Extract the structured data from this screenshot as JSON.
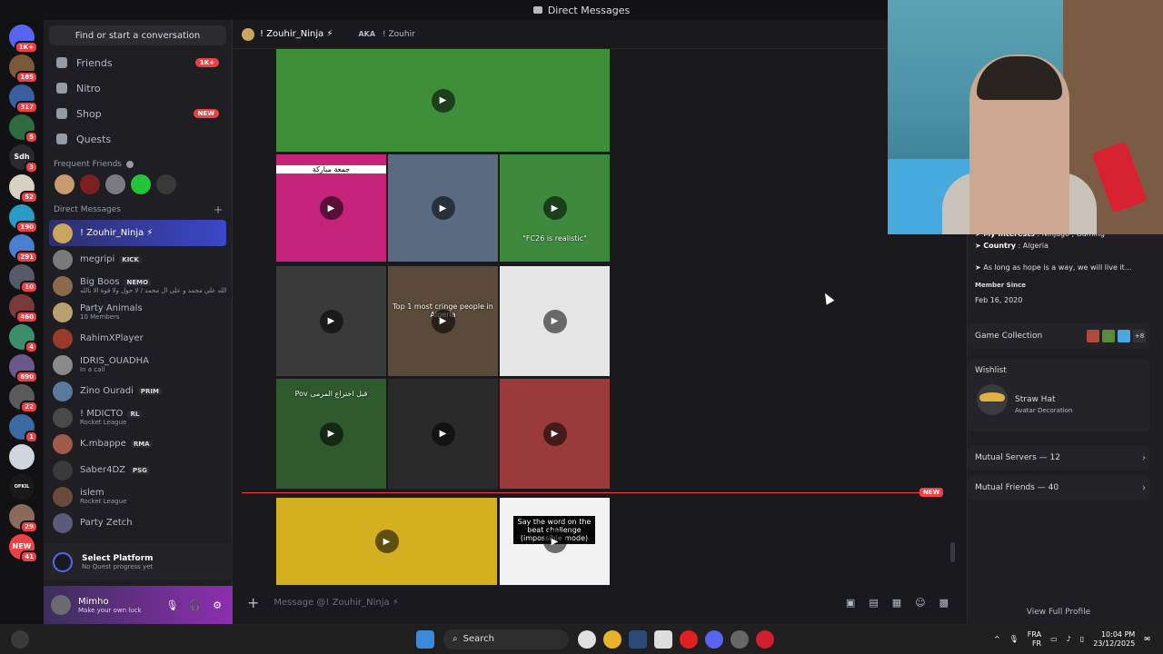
{
  "window": {
    "title": "Direct Messages"
  },
  "rail": {
    "servers": [
      {
        "badge": "1K+",
        "color": "#5865f2",
        "label": ""
      },
      {
        "badge": "185",
        "color": "#7b5a3b",
        "label": ""
      },
      {
        "badge": "317",
        "color": "#3a5fa0",
        "label": ""
      },
      {
        "badge": "5",
        "color": "#2f6b3d",
        "label": ""
      },
      {
        "badge": "3",
        "color": "#2a2a2f",
        "label": "Sdh"
      },
      {
        "badge": "52",
        "color": "#d8d0c0",
        "label": ""
      },
      {
        "badge": "190",
        "color": "#2a9bc4",
        "label": ""
      },
      {
        "badge": "291",
        "color": "#4a7ed0",
        "label": ""
      },
      {
        "badge": "10",
        "color": "#555a66",
        "label": ""
      },
      {
        "badge": "460",
        "color": "#7a3a3a",
        "label": ""
      },
      {
        "badge": "4",
        "color": "#3a8f6a",
        "label": ""
      },
      {
        "badge": "690",
        "color": "#6a5a8a",
        "label": ""
      },
      {
        "badge": "22",
        "color": "#5a5a5a",
        "label": ""
      },
      {
        "badge": "1",
        "color": "#3a6aa0",
        "label": ""
      },
      {
        "badge": "",
        "color": "#d0d6e0",
        "label": ""
      },
      {
        "badge": "",
        "color": "#1a1a1a",
        "label": "OFKIL TEAM"
      },
      {
        "badge": "29",
        "color": "#8a6a5a",
        "label": ""
      },
      {
        "badge": "41",
        "color": "#f23f43",
        "label": "NEW"
      }
    ]
  },
  "sidebar": {
    "find_placeholder": "Find or start a conversation",
    "nav": [
      {
        "label": "Friends",
        "badge": "1K+",
        "icon": "friends-icon"
      },
      {
        "label": "Nitro",
        "badge": "",
        "icon": "nitro-icon"
      },
      {
        "label": "Shop",
        "badge": "NEW",
        "icon": "shop-icon"
      },
      {
        "label": "Quests",
        "badge": "",
        "icon": "quests-icon"
      }
    ],
    "frequent_title": "Frequent Friends",
    "dm_title": "Direct Messages",
    "dms": [
      {
        "name": "! Zouhir_Ninja ⚡",
        "sub": "",
        "tag": "",
        "color": "#c9a55d",
        "active": true
      },
      {
        "name": "megripi",
        "sub": "",
        "tag": "KICK",
        "color": "#7a7a7a"
      },
      {
        "name": "Big Boos",
        "sub": "صلى الله على محمد و على ال محمد / لا حول ولا قوة الا بالله",
        "tag": "NEMO",
        "color": "#8a6a4a"
      },
      {
        "name": "Party Animals",
        "sub": "10 Members",
        "tag": "",
        "color": "#b8a070"
      },
      {
        "name": "RahimXPlayer",
        "sub": "",
        "tag": "",
        "color": "#9a3a2a"
      },
      {
        "name": "IDRIS_OUADHA",
        "sub": "In a call",
        "tag": "",
        "color": "#8a8a8a"
      },
      {
        "name": "Zino Ouradi",
        "sub": "",
        "tag": "PRIM",
        "color": "#5a7aa0"
      },
      {
        "name": "! MDICTO",
        "sub": "Rocket League",
        "tag": "RL",
        "color": "#4a4a4a"
      },
      {
        "name": "K.mbappe",
        "sub": "",
        "tag": "RMA",
        "color": "#a05a4a"
      },
      {
        "name": "Saber4DZ",
        "sub": "",
        "tag": "PSG",
        "color": "#3a3a3a"
      },
      {
        "name": "islem",
        "sub": "Rocket League",
        "tag": "",
        "color": "#6a4a3a"
      },
      {
        "name": "Party Zetch",
        "sub": "",
        "tag": "",
        "color": "#5a5a7a"
      }
    ],
    "platform": {
      "title": "Select Platform",
      "sub": "No Quest progress yet"
    },
    "user": {
      "name": "Mimho",
      "status": "Make your own luck"
    }
  },
  "chat": {
    "recipient": "! Zouhir_Ninja ⚡",
    "aka_label": "AKA",
    "aka_name": "! Zouhir",
    "new_label": "NEW",
    "input_placeholder": "Message @! Zouhir_Ninja ⚡",
    "media": [
      {
        "caption": "",
        "color": "#3f8f3a"
      },
      {
        "caption": "جمعة مباركة",
        "color": "#c6237a"
      },
      {
        "caption": "",
        "color": "#5a6a80"
      },
      {
        "caption": "\"FC26 is realistic\"",
        "color": "#3d8a3d"
      },
      {
        "caption": "",
        "color": "#3a3a3a"
      },
      {
        "caption": "Top 1 most cringe people in Algeria",
        "color": "#5a4a3a"
      },
      {
        "caption": "",
        "color": "#e6e6e6"
      },
      {
        "caption": "Pov قبل اختراع المرمى",
        "color": "#2e5a2e"
      },
      {
        "caption": "",
        "color": "#2a2a2a"
      },
      {
        "caption": "",
        "color": "#9a3a3a"
      },
      {
        "caption": "",
        "color": "#d4b020"
      },
      {
        "caption": "Say the word on the beat challenge (impossible mode)",
        "color": "#f2f2f2"
      }
    ]
  },
  "profile": {
    "interests_label": "My Interests",
    "interests": "Ninjago , Gaming",
    "country_label": "Country",
    "country": "Algeria",
    "quote": "As long as hope is a way, we will live it...",
    "member_since_label": "Member Since",
    "member_since": "Feb 16, 2020",
    "game_collection": "Game Collection",
    "game_more": "+8",
    "wishlist": "Wishlist",
    "wish_item": "Straw Hat",
    "wish_type": "Avatar Decoration",
    "mutual_servers": "Mutual Servers — 12",
    "mutual_friends": "Mutual Friends — 40",
    "view_full": "View Full Profile"
  },
  "taskbar": {
    "search": "Search",
    "lang1": "FRA",
    "lang2": "FR",
    "time": "10:04 PM",
    "date": "23/12/2025"
  }
}
